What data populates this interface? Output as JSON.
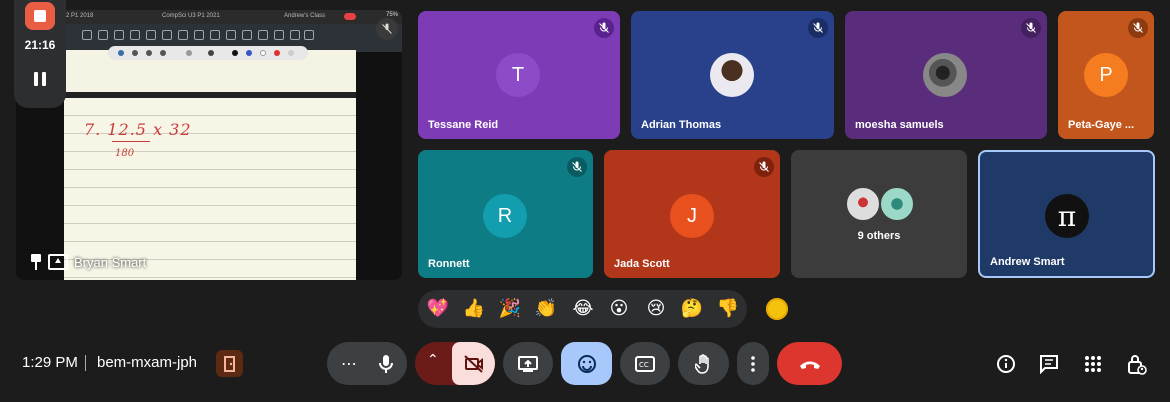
{
  "recording": {
    "timer": "21:16"
  },
  "presentation": {
    "presenter_name": "Bryan Smart",
    "tabs": [
      "2 P1 2018",
      "CompSci U3 P1 2021",
      "Andrew's Class"
    ],
    "status": "75%",
    "handwriting": {
      "expression": "7. 12.5 x 32",
      "note": "180"
    }
  },
  "participants": [
    {
      "name": "Tessane Reid",
      "initial": "T",
      "bg": "#7d3cb5",
      "avatar_color": "#8e4bc7",
      "muted": true
    },
    {
      "name": "Adrian Thomas",
      "initial": "",
      "bg": "#28418a",
      "avatar_color": "#ffffff",
      "muted": true,
      "photo": true
    },
    {
      "name": "moesha samuels",
      "initial": "",
      "bg": "#5a2d7c",
      "avatar_color": "#666666",
      "muted": true,
      "photo": true
    },
    {
      "name": "Peta-Gaye ...",
      "initial": "P",
      "bg": "#c2561c",
      "avatar_color": "#f57c1f",
      "muted": true
    },
    {
      "name": "Ronnett",
      "initial": "R",
      "bg": "#0d7c84",
      "avatar_color": "#129eaf",
      "muted": true
    },
    {
      "name": "Jada Scott",
      "initial": "J",
      "bg": "#b2361a",
      "avatar_color": "#e8501d",
      "muted": true
    },
    {
      "name": "Andrew Smart",
      "initial": "π",
      "bg": "#1f3a66",
      "avatar_color": "#111111",
      "muted": false
    }
  ],
  "others": {
    "label": "9 others"
  },
  "reactions": [
    {
      "name": "sparkling-heart",
      "glyph": "💖"
    },
    {
      "name": "thumbs-up",
      "glyph": "👍"
    },
    {
      "name": "party-popper",
      "glyph": "🎉"
    },
    {
      "name": "clapping-hands",
      "glyph": "👏"
    },
    {
      "name": "tears-of-joy",
      "glyph": "😂"
    },
    {
      "name": "surprised",
      "glyph": "😮"
    },
    {
      "name": "sad",
      "glyph": "😢"
    },
    {
      "name": "thinking",
      "glyph": "🤔"
    },
    {
      "name": "thumbs-down",
      "glyph": "👎"
    }
  ],
  "bottom_bar": {
    "time": "1:29 PM",
    "meeting_code": "bem-mxam-jph"
  },
  "colors": {
    "accent_blue": "#a8c7fa",
    "leave_red": "#dc362e",
    "rec_red": "#ea5d45"
  }
}
